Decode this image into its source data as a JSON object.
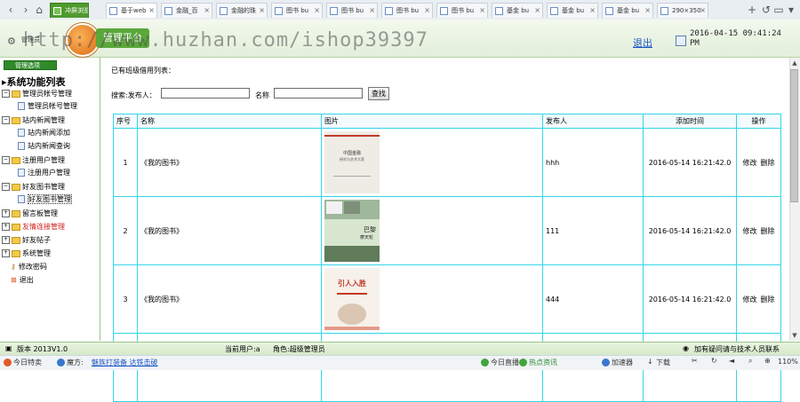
{
  "tabs": [
    {
      "label": "冲屏浏览",
      "style": "green"
    },
    {
      "label": "基于web",
      "style": "active"
    },
    {
      "label": "金融_百",
      "style": "normal"
    },
    {
      "label": "金融的珠",
      "style": "normal"
    },
    {
      "label": "图书 bu",
      "style": "normal"
    },
    {
      "label": "图书 bu",
      "style": "normal"
    },
    {
      "label": "图书 bu",
      "style": "normal"
    },
    {
      "label": "图书 bu",
      "style": "normal"
    },
    {
      "label": "基金 bu",
      "style": "normal"
    },
    {
      "label": "基金 bu",
      "style": "normal"
    },
    {
      "label": "基金 bu",
      "style": "normal"
    },
    {
      "label": "290×350",
      "style": "normal"
    }
  ],
  "header": {
    "watermark": "http://www.huzhan.com/ishop39397",
    "logo_text": "管理平台",
    "user_label": "管理员",
    "logout": "退出",
    "datetime_line1": "2016-04-15 09:41:24",
    "datetime_line2": "PM"
  },
  "sidebar": {
    "heading": "管理选项",
    "root": "系统功能列表",
    "groups": [
      {
        "label": "管理员帐号管理",
        "items": [
          "管理员帐号管理"
        ]
      },
      {
        "label": "站内新闻管理",
        "items": [
          "站内新闻添加",
          "站内新闻查询"
        ]
      },
      {
        "label": "注册用户管理",
        "items": [
          "注册用户管理"
        ]
      },
      {
        "label": "好友图书管理",
        "items": [
          "好友图书管理"
        ]
      },
      {
        "label": "留言板管理",
        "items": []
      },
      {
        "label": "友情连接管理",
        "items": []
      },
      {
        "label": "好友帖子",
        "items": []
      },
      {
        "label": "系统管理",
        "items": []
      }
    ],
    "extra": [
      "修改密码",
      "退出"
    ]
  },
  "main": {
    "title": "已有班级借用列表：",
    "search_label": "搜索:发布人：",
    "name_label": "名称",
    "search_button": "查找",
    "columns": [
      "序号",
      "名称",
      "图片",
      "发布人",
      "添加时间",
      "操作"
    ],
    "rows": [
      {
        "no": "1",
        "name": "《我的图书》",
        "publisher": "hhh",
        "time": "2016-05-14 16:21:42.0",
        "edit": "修改",
        "delete": "删除",
        "cover_title": "中国金融研究与艺术大家"
      },
      {
        "no": "2",
        "name": "《我的图书》",
        "publisher": "111",
        "time": "2016-05-14 16:21:42.0",
        "edit": "修改",
        "delete": "删除",
        "cover_title": "巴黎 摩天轮"
      },
      {
        "no": "3",
        "name": "《我的图书》",
        "publisher": "444",
        "time": "2016-05-14 16:21:42.0",
        "edit": "修改",
        "delete": "删除",
        "cover_title": "引人入胜"
      }
    ]
  },
  "footer": {
    "version": "版本 2013V1.0",
    "current_user": "当前用户:a",
    "role": "角色:超级管理员",
    "help": "加有疑问请与技术人员联系"
  },
  "statusbar": {
    "left1": "今日特卖",
    "left2": "魔方:",
    "link": "魅族打装备 达铁击破",
    "right": [
      "今日直播",
      "热点资讯",
      "加速器",
      "下载"
    ],
    "zoom": "110%"
  },
  "colors": {
    "accent_green": "#2f8a2a",
    "table_border": "#33d6e6",
    "link_blue": "#1b54c5"
  }
}
